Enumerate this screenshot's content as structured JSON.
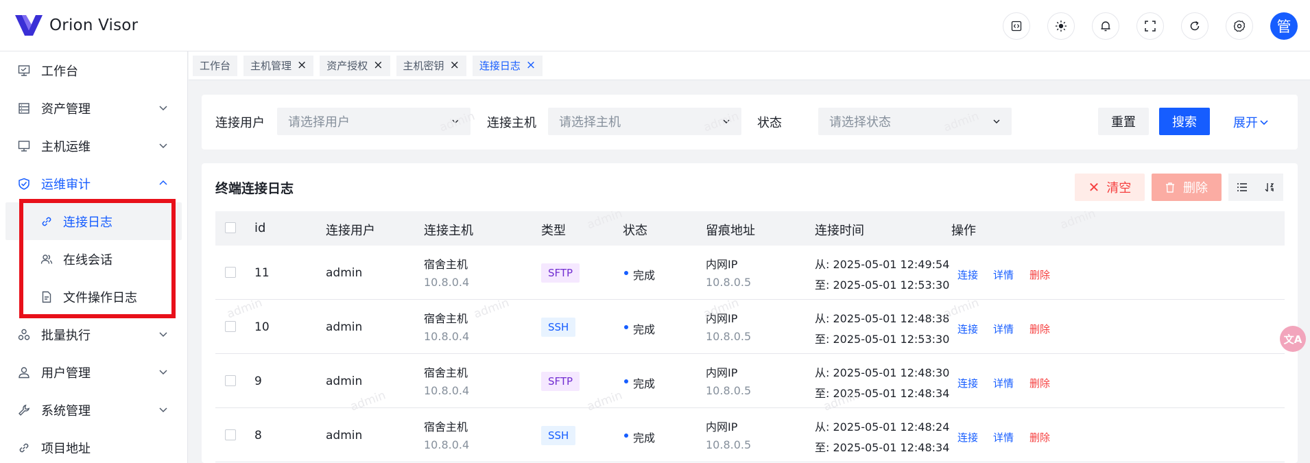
{
  "app": {
    "name": "Orion Visor",
    "avatar_text": "管"
  },
  "header": {
    "icons": [
      "code-icon",
      "sun-icon",
      "bell-icon",
      "fullscreen-icon",
      "refresh-icon",
      "gear-icon"
    ]
  },
  "sidebar": {
    "items": [
      {
        "label": "工作台",
        "icon": "monitor-icon"
      },
      {
        "label": "资产管理",
        "icon": "database-icon",
        "has_children": true
      },
      {
        "label": "主机运维",
        "icon": "desktop-icon",
        "has_children": true
      },
      {
        "label": "运维审计",
        "icon": "shield-icon",
        "has_children": true,
        "open": true,
        "children": [
          {
            "label": "连接日志",
            "icon": "link-icon",
            "active": true
          },
          {
            "label": "在线会话",
            "icon": "users-icon"
          },
          {
            "label": "文件操作日志",
            "icon": "file-icon"
          }
        ]
      },
      {
        "label": "批量执行",
        "icon": "nodes-icon",
        "has_children": true
      },
      {
        "label": "用户管理",
        "icon": "user-icon",
        "has_children": true
      },
      {
        "label": "系统管理",
        "icon": "wrench-icon",
        "has_children": true
      },
      {
        "label": "项目地址",
        "icon": "link-icon"
      }
    ]
  },
  "tabs": [
    {
      "label": "工作台",
      "closable": false
    },
    {
      "label": "主机管理",
      "closable": true
    },
    {
      "label": "资产授权",
      "closable": true
    },
    {
      "label": "主机密钥",
      "closable": true
    },
    {
      "label": "连接日志",
      "closable": true,
      "active": true
    }
  ],
  "filters": {
    "user_label": "连接用户",
    "user_placeholder": "请选择用户",
    "host_label": "连接主机",
    "host_placeholder": "请选择主机",
    "status_label": "状态",
    "status_placeholder": "请选择状态",
    "reset": "重置",
    "search": "搜索",
    "expand": "展开"
  },
  "table": {
    "title": "终端连接日志",
    "clear": "清空",
    "delete": "删除",
    "columns": [
      "id",
      "连接用户",
      "连接主机",
      "类型",
      "状态",
      "留痕地址",
      "连接时间",
      "操作"
    ],
    "rows": [
      {
        "id": "11",
        "user": "admin",
        "host": "宿舍主机",
        "host_ip": "10.8.0.4",
        "type": "SFTP",
        "status": "完成",
        "trace": "内网IP",
        "trace_ip": "10.8.0.5",
        "from": "从: 2025-05-01 12:49:54",
        "to": "至: 2025-05-01 12:53:30"
      },
      {
        "id": "10",
        "user": "admin",
        "host": "宿舍主机",
        "host_ip": "10.8.0.4",
        "type": "SSH",
        "status": "完成",
        "trace": "内网IP",
        "trace_ip": "10.8.0.5",
        "from": "从: 2025-05-01 12:48:38",
        "to": "至: 2025-05-01 12:53:30"
      },
      {
        "id": "9",
        "user": "admin",
        "host": "宿舍主机",
        "host_ip": "10.8.0.4",
        "type": "SFTP",
        "status": "完成",
        "trace": "内网IP",
        "trace_ip": "10.8.0.5",
        "from": "从: 2025-05-01 12:48:30",
        "to": "至: 2025-05-01 12:48:34"
      },
      {
        "id": "8",
        "user": "admin",
        "host": "宿舍主机",
        "host_ip": "10.8.0.4",
        "type": "SSH",
        "status": "完成",
        "trace": "内网IP",
        "trace_ip": "10.8.0.5",
        "from": "从: 2025-05-01 12:48:24",
        "to": "至: 2025-05-01 12:48:34"
      }
    ],
    "ops": {
      "connect": "连接",
      "detail": "详情",
      "delete": "删除"
    }
  },
  "watermark": "admin",
  "translate_badge": "文A",
  "colors": {
    "accent": "#165dff",
    "danger": "#f53f3f",
    "highlight": "#e8101a"
  }
}
